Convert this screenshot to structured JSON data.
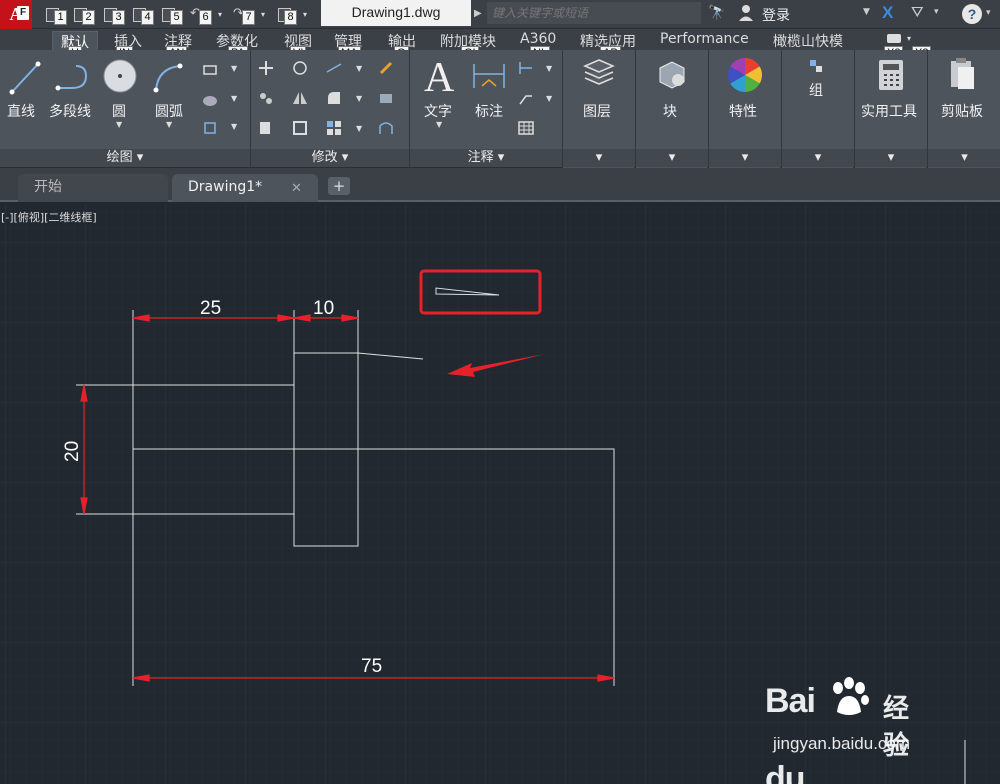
{
  "titlebar": {
    "app_logo_letter": "A",
    "app_logo_badge": "F",
    "quick_access_keytips": [
      "1",
      "2",
      "3",
      "4",
      "5",
      "6",
      "7",
      "8"
    ],
    "document_title": "Drawing1.dwg",
    "search_placeholder": "键入关键字或短语",
    "login_label": "登录"
  },
  "ribbon_tabs": [
    {
      "label": "默认",
      "keytip": "H",
      "active": true
    },
    {
      "label": "插入",
      "keytip": "IN"
    },
    {
      "label": "注释",
      "keytip": "AN"
    },
    {
      "label": "参数化",
      "keytip": "PA"
    },
    {
      "label": "视图",
      "keytip": "VI"
    },
    {
      "label": "管理",
      "keytip": "MA"
    },
    {
      "label": "输出",
      "keytip": "O"
    },
    {
      "label": "附加模块",
      "keytip": "GI"
    },
    {
      "label": "A360",
      "keytip": "NL"
    },
    {
      "label": "精选应用",
      "keytip": "AP"
    },
    {
      "label": "Performance"
    },
    {
      "label": "橄榄山快模"
    }
  ],
  "extra_keytips": [
    "X2",
    "X3"
  ],
  "ribbon": {
    "draw": {
      "title": "绘图",
      "line": "直线",
      "polyline": "多段线",
      "circle": "圆",
      "arc": "圆弧"
    },
    "modify": {
      "title": "修改"
    },
    "annotation": {
      "title": "注释",
      "text": "文字",
      "dimension": "标注"
    },
    "layers": "图层",
    "block": "块",
    "properties": "特性",
    "group": "组",
    "utilities": "实用工具",
    "clipboard": "剪贴板"
  },
  "doc_tabs": {
    "start": "开始",
    "drawing": "Drawing1*"
  },
  "viewport_label": "[-][俯视][二维线框]",
  "dimensions": {
    "d25": "25",
    "d10": "10",
    "d20": "20",
    "d75": "75"
  },
  "watermark": {
    "brand": "Bai",
    "brand_tail": "du",
    "cn": "经验",
    "url": "jingyan.baidu.com"
  },
  "colors": {
    "background": "#212830",
    "dimension": "#e8202a",
    "geometry": "#e0e0e0",
    "highlight": "#e8202a"
  }
}
